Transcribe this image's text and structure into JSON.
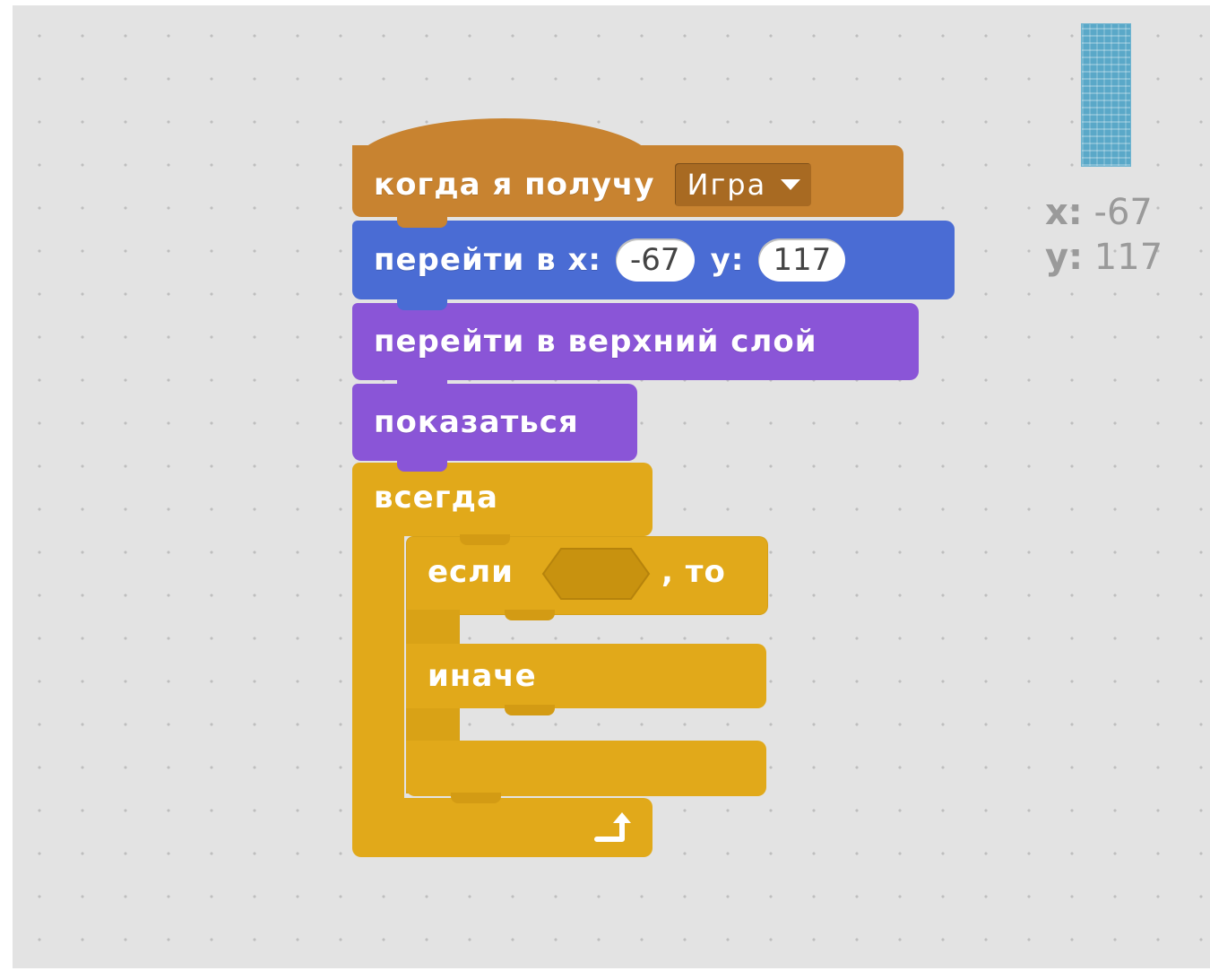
{
  "hat_block": {
    "label": "когда я получу",
    "message_value": "Игра"
  },
  "motion_block": {
    "label": "перейти в x:",
    "x_value": "-67",
    "y_label": "y:",
    "y_value": "117"
  },
  "looks_blocks": [
    {
      "label": "перейти в верхний слой"
    },
    {
      "label": "показаться"
    }
  ],
  "forever_block": {
    "label": "всегда"
  },
  "if_else_block": {
    "if_label": "если",
    "then_label": ", то",
    "else_label": "иначе"
  },
  "sprite_info": {
    "x_key": "x:",
    "x_value": "-67",
    "y_key": "y:",
    "y_value": "117"
  },
  "colors": {
    "events": "#c88330",
    "motion": "#4a6cd4",
    "looks": "#8a55d7",
    "control": "#e1a91a",
    "workspace": "#e3e3e3"
  },
  "icons": {
    "dropdown": "caret-down-icon",
    "loop": "loop-arrow-icon"
  }
}
